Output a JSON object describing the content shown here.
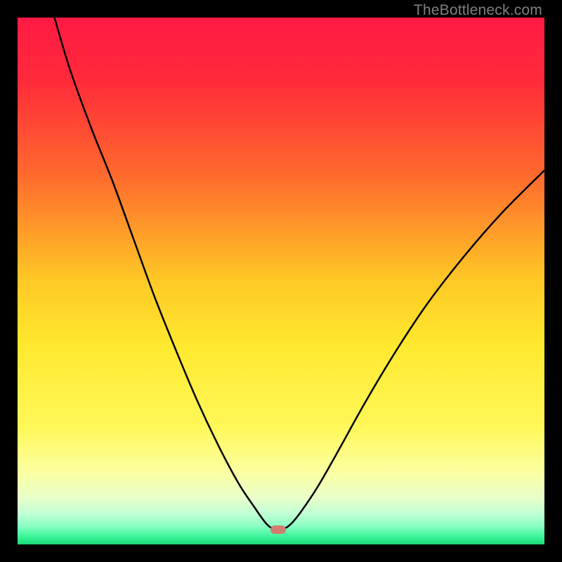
{
  "watermark": {
    "text": "TheBottleneck.com"
  },
  "colors": {
    "gradient_stops": [
      {
        "pct": 0,
        "color": "#ff1a44"
      },
      {
        "pct": 12,
        "color": "#ff2b3a"
      },
      {
        "pct": 30,
        "color": "#ff6a2d"
      },
      {
        "pct": 50,
        "color": "#ffc926"
      },
      {
        "pct": 62,
        "color": "#ffe82e"
      },
      {
        "pct": 78,
        "color": "#fff85a"
      },
      {
        "pct": 86,
        "color": "#fbffa0"
      },
      {
        "pct": 91,
        "color": "#e9ffc8"
      },
      {
        "pct": 94,
        "color": "#c4ffd5"
      },
      {
        "pct": 96.5,
        "color": "#8affc3"
      },
      {
        "pct": 98.5,
        "color": "#3cf59a"
      },
      {
        "pct": 100,
        "color": "#18d877"
      }
    ],
    "curve_stroke": "#000000",
    "marker_fill": "#d07e70"
  },
  "marker": {
    "x_pct": 49.5,
    "y_pct": 97.2
  },
  "chart_data": {
    "type": "line",
    "title": "",
    "xlabel": "",
    "ylabel": "",
    "xlim_pct": [
      0,
      100
    ],
    "ylim_pct": [
      0,
      100
    ],
    "note": "Axes are unlabeled in the source image; values are normalized 0–100 in screen percent. y=0 is the top of the plot area (as drawn). The curve is the black V-shaped trace; the marker is the small rounded pill at the trough.",
    "series": [
      {
        "name": "bottleneck-curve",
        "points_pct": [
          {
            "x": 7.0,
            "y": 0.0
          },
          {
            "x": 10.0,
            "y": 10.0
          },
          {
            "x": 14.0,
            "y": 21.0
          },
          {
            "x": 18.0,
            "y": 31.0
          },
          {
            "x": 22.0,
            "y": 42.0
          },
          {
            "x": 26.0,
            "y": 53.0
          },
          {
            "x": 30.0,
            "y": 63.0
          },
          {
            "x": 34.0,
            "y": 72.5
          },
          {
            "x": 38.0,
            "y": 81.0
          },
          {
            "x": 42.0,
            "y": 88.5
          },
          {
            "x": 45.0,
            "y": 93.0
          },
          {
            "x": 47.0,
            "y": 95.8
          },
          {
            "x": 48.5,
            "y": 97.0
          },
          {
            "x": 50.5,
            "y": 97.0
          },
          {
            "x": 52.0,
            "y": 96.0
          },
          {
            "x": 54.0,
            "y": 93.5
          },
          {
            "x": 57.0,
            "y": 89.0
          },
          {
            "x": 61.0,
            "y": 82.0
          },
          {
            "x": 66.0,
            "y": 73.0
          },
          {
            "x": 72.0,
            "y": 63.0
          },
          {
            "x": 78.0,
            "y": 54.0
          },
          {
            "x": 85.0,
            "y": 45.0
          },
          {
            "x": 92.0,
            "y": 37.0
          },
          {
            "x": 100.0,
            "y": 29.0
          }
        ]
      }
    ]
  }
}
